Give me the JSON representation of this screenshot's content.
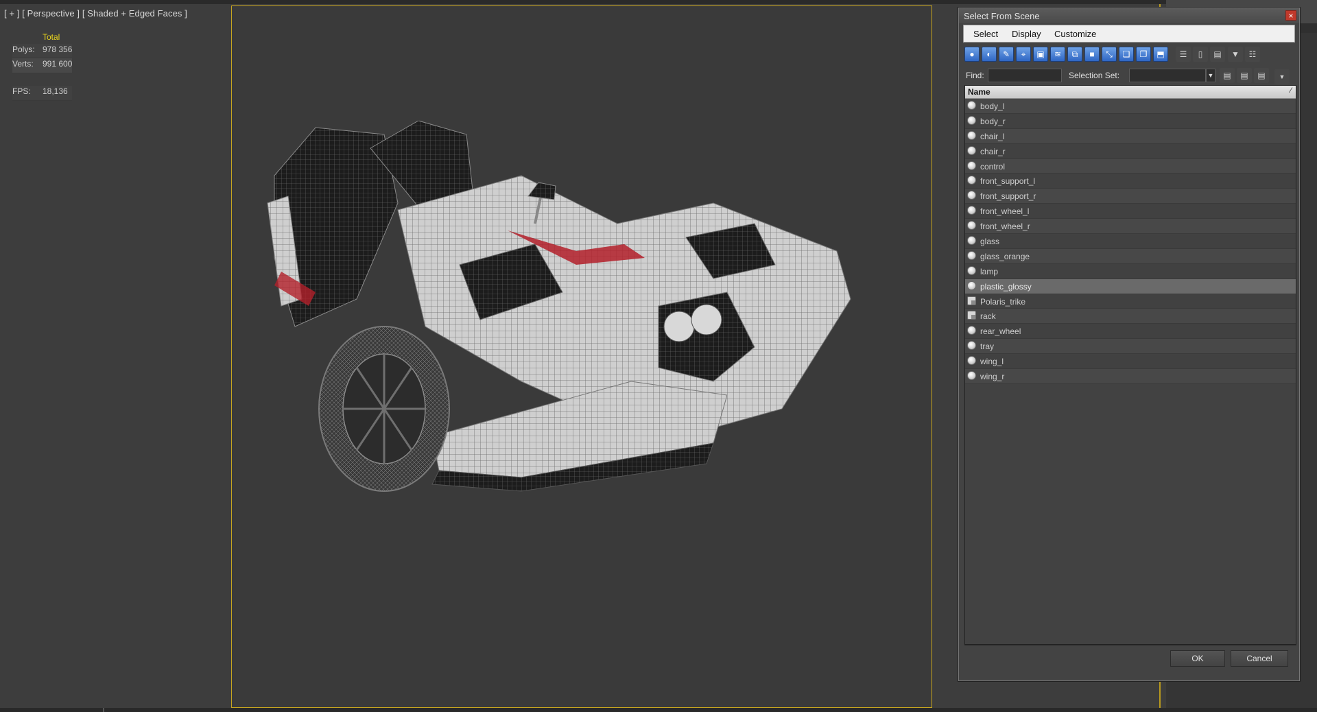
{
  "viewport": {
    "label": "[ + ] [ Perspective ] [ Shaded + Edged Faces ]",
    "stats": {
      "total_label": "Total",
      "polys_label": "Polys:",
      "polys_value": "978 356",
      "verts_label": "Verts:",
      "verts_value": "991 600",
      "fps_label": "FPS:",
      "fps_value": "18,136"
    }
  },
  "dialog": {
    "title": "Select From Scene",
    "close_glyph": "×",
    "menu": [
      "Select",
      "Display",
      "Customize"
    ],
    "find_label": "Find:",
    "find_value": "",
    "selection_set_label": "Selection Set:",
    "selection_set_value": "",
    "column_header": "Name",
    "sort_glyph": "⁄",
    "objects": [
      {
        "name": "body_l",
        "icon": "sphere-icon"
      },
      {
        "name": "body_r",
        "icon": "sphere-icon"
      },
      {
        "name": "chair_l",
        "icon": "sphere-icon"
      },
      {
        "name": "chair_r",
        "icon": "sphere-icon"
      },
      {
        "name": "control",
        "icon": "sphere-icon"
      },
      {
        "name": "front_support_l",
        "icon": "sphere-icon"
      },
      {
        "name": "front_support_r",
        "icon": "sphere-icon"
      },
      {
        "name": "front_wheel_l",
        "icon": "sphere-icon"
      },
      {
        "name": "front_wheel_r",
        "icon": "sphere-icon"
      },
      {
        "name": "glass",
        "icon": "sphere-icon"
      },
      {
        "name": "glass_orange",
        "icon": "sphere-icon"
      },
      {
        "name": "lamp",
        "icon": "sphere-icon"
      },
      {
        "name": "plastic_glossy",
        "icon": "sphere-icon",
        "selected": true
      },
      {
        "name": "Polaris_trike",
        "icon": "group-icon"
      },
      {
        "name": "rack",
        "icon": "group-icon"
      },
      {
        "name": "rear_wheel",
        "icon": "sphere-icon"
      },
      {
        "name": "tray",
        "icon": "sphere-icon"
      },
      {
        "name": "wing_l",
        "icon": "sphere-icon"
      },
      {
        "name": "wing_r",
        "icon": "sphere-icon"
      }
    ],
    "ok_label": "OK",
    "cancel_label": "Cancel"
  },
  "colors": {
    "viewport_bg": "#3d3d3d",
    "stats_text": "#e8d31d",
    "safe_frame": "#c6a51f",
    "toolbar_accent": "#2f66c4"
  }
}
